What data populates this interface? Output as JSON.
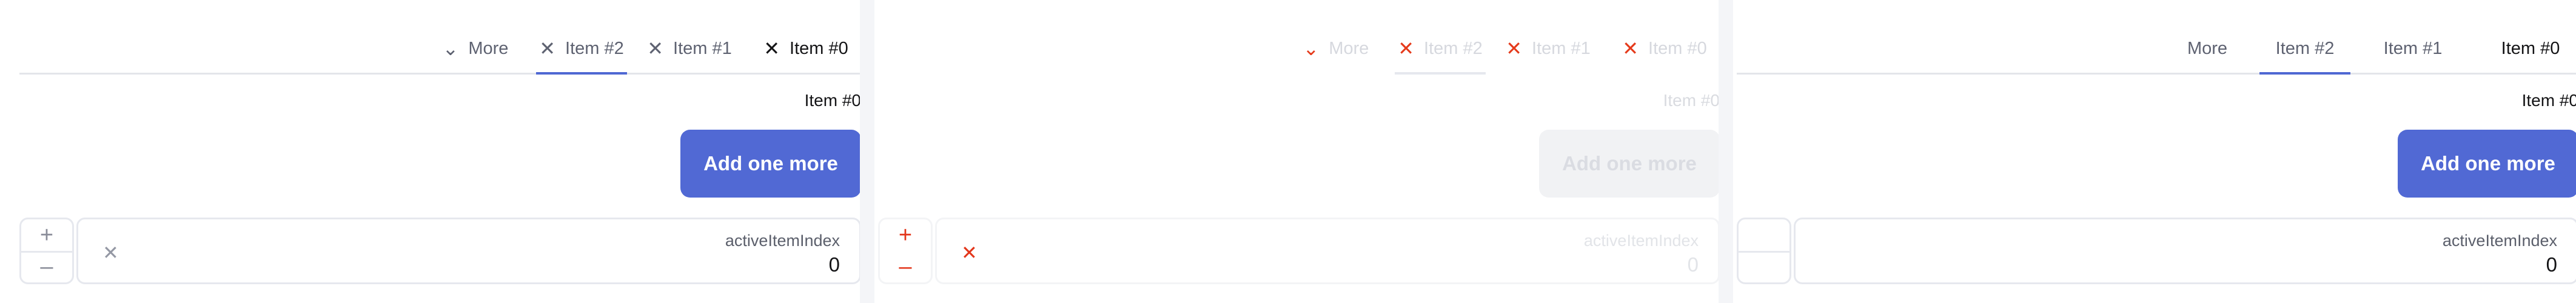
{
  "tabs": {
    "more_label": "More",
    "items": [
      "Item #2",
      "Item #1",
      "Item #0"
    ]
  },
  "icons": {
    "chevron": "⌵",
    "close": "✕",
    "plus": "+",
    "minus": "–"
  },
  "content": {
    "current_item": "Item #0",
    "add_button_label": "Add one more"
  },
  "field": {
    "label": "activeItemIndex",
    "value": "0"
  },
  "colors": {
    "accent": "#5169d4",
    "danger": "#e3361b"
  }
}
